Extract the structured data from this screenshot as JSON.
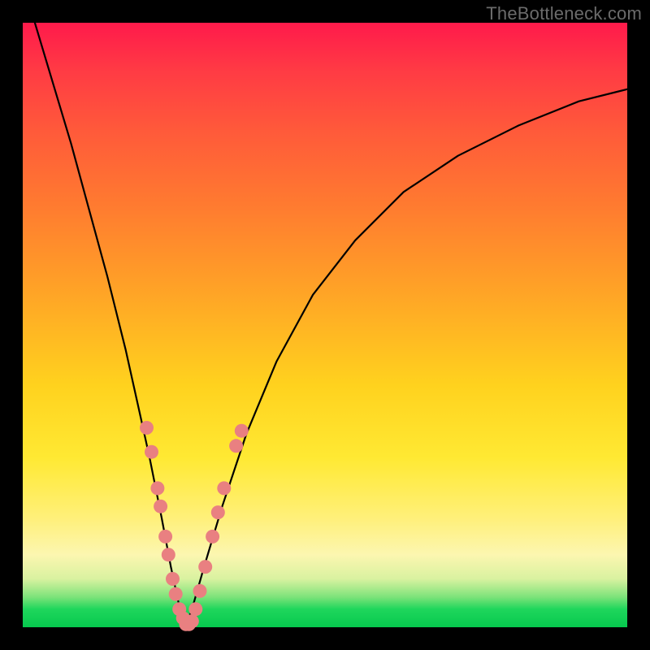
{
  "watermark": {
    "text": "TheBottleneck.com"
  },
  "chart_data": {
    "type": "line",
    "title": "",
    "xlabel": "",
    "ylabel": "",
    "ylim": [
      0,
      100
    ],
    "xlim": [
      0,
      100
    ],
    "series": [
      {
        "name": "bottleneck-curve",
        "x": [
          2,
          5,
          8,
          11,
          14,
          17,
          19,
          21,
          23,
          24.5,
          26,
          27,
          28,
          30,
          33,
          37,
          42,
          48,
          55,
          63,
          72,
          82,
          92,
          100
        ],
        "y": [
          100,
          90,
          80,
          69,
          58,
          46,
          37,
          28,
          18,
          10,
          3,
          0,
          3,
          10,
          20,
          32,
          44,
          55,
          64,
          72,
          78,
          83,
          87,
          89
        ]
      }
    ],
    "markers": {
      "name": "highlight-dots",
      "color": "#e98081",
      "points": [
        {
          "x": 20.5,
          "y": 33
        },
        {
          "x": 21.3,
          "y": 29
        },
        {
          "x": 22.3,
          "y": 23
        },
        {
          "x": 22.8,
          "y": 20
        },
        {
          "x": 23.6,
          "y": 15
        },
        {
          "x": 24.1,
          "y": 12
        },
        {
          "x": 24.8,
          "y": 8
        },
        {
          "x": 25.3,
          "y": 5.5
        },
        {
          "x": 25.9,
          "y": 3
        },
        {
          "x": 26.5,
          "y": 1.5
        },
        {
          "x": 27.0,
          "y": 0.5
        },
        {
          "x": 27.5,
          "y": 0.5
        },
        {
          "x": 28.0,
          "y": 1
        },
        {
          "x": 28.6,
          "y": 3
        },
        {
          "x": 29.3,
          "y": 6
        },
        {
          "x": 30.2,
          "y": 10
        },
        {
          "x": 31.4,
          "y": 15
        },
        {
          "x": 32.3,
          "y": 19
        },
        {
          "x": 33.3,
          "y": 23
        },
        {
          "x": 35.3,
          "y": 30
        },
        {
          "x": 36.2,
          "y": 32.5
        }
      ]
    },
    "background_gradient": {
      "top": "#ff1a4b",
      "mid": "#ffd21e",
      "bottom": "#06c94e"
    }
  }
}
